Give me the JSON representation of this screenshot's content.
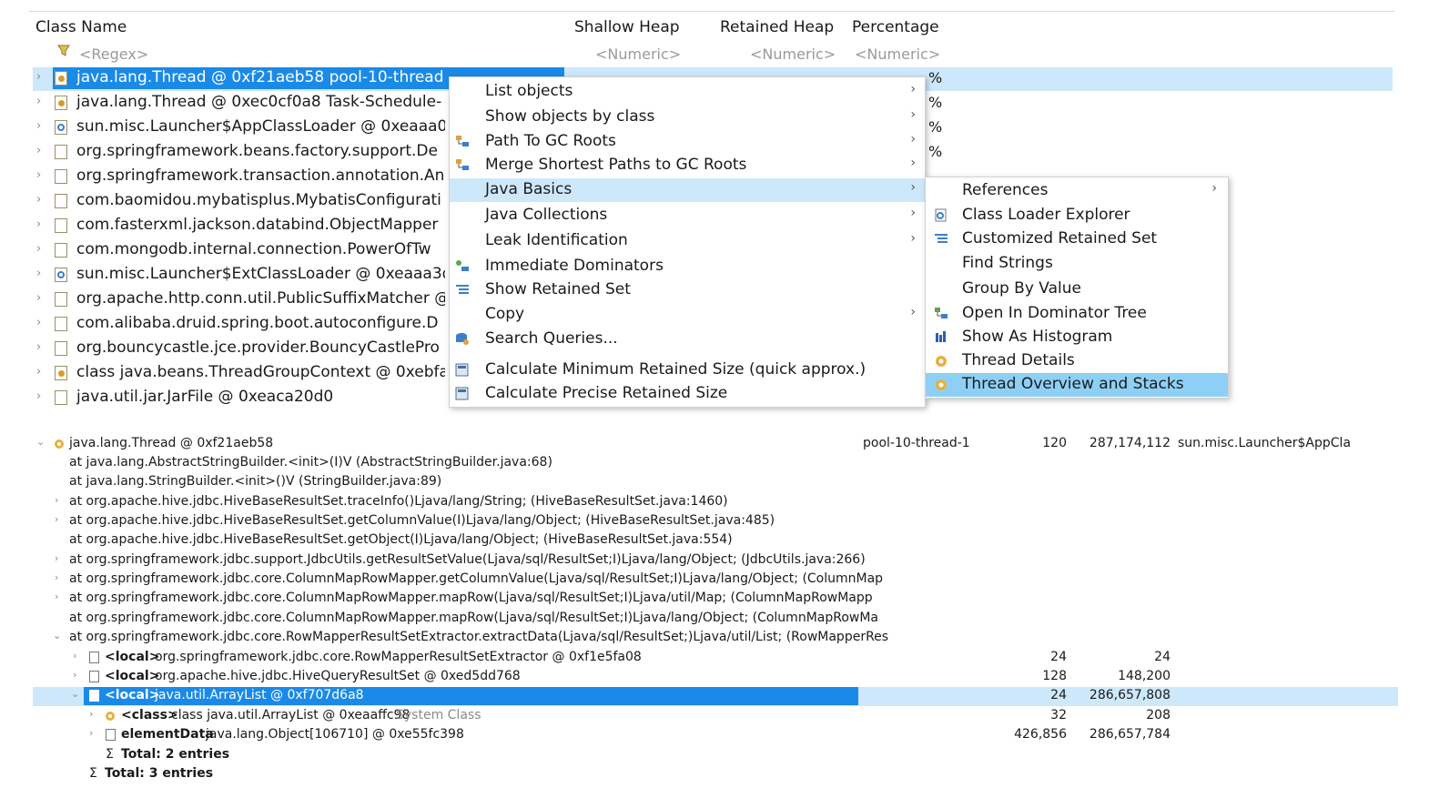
{
  "columns": {
    "class_name": "Class Name",
    "shallow_heap": "Shallow Heap",
    "retained_heap": "Retained Heap",
    "percentage": "Percentage"
  },
  "filters": {
    "regex": "<Regex>",
    "numeric": "<Numeric>"
  },
  "rows": [
    {
      "label": "java.lang.Thread @ 0xf21aeb58  pool-10-thread",
      "icon": "thread-icon"
    },
    {
      "label": "java.lang.Thread @ 0xec0cf0a8  Task-Schedule-",
      "icon": "thread-icon"
    },
    {
      "label": "sun.misc.Launcher$AppClassLoader @ 0xeaaa0",
      "icon": "classloader-icon"
    },
    {
      "label": "org.springframework.beans.factory.support.De",
      "icon": "object-icon"
    },
    {
      "label": "org.springframework.transaction.annotation.An",
      "icon": "object-icon"
    },
    {
      "label": "com.baomidou.mybatisplus.MybatisConfigurati",
      "icon": "object-icon"
    },
    {
      "label": "com.fasterxml.jackson.databind.ObjectMapper",
      "icon": "object-icon"
    },
    {
      "label": "com.mongodb.internal.connection.PowerOfTw",
      "icon": "object-icon"
    },
    {
      "label": "sun.misc.Launcher$ExtClassLoader @ 0xeaaa3d",
      "icon": "classloader-icon"
    },
    {
      "label": "org.apache.http.conn.util.PublicSuffixMatcher @",
      "icon": "object-icon"
    },
    {
      "label": "com.alibaba.druid.spring.boot.autoconfigure.D",
      "icon": "object-icon"
    },
    {
      "label": "org.bouncycastle.jce.provider.BouncyCastlePro",
      "icon": "object-icon"
    },
    {
      "label": "class java.beans.ThreadGroupContext @ 0xebfa",
      "icon": "class-icon"
    },
    {
      "label": "java.util.jar.JarFile @ 0xeaca20d0",
      "icon": "object-icon"
    }
  ],
  "pct_marks": [
    "%",
    "%",
    "%",
    "%"
  ],
  "context_menu": {
    "items": [
      {
        "label": "List objects",
        "submenu": true
      },
      {
        "label": "Show objects by class",
        "submenu": true
      },
      {
        "label": "Path To GC Roots",
        "submenu": true,
        "icon": "path-gc-icon"
      },
      {
        "label": "Merge Shortest Paths to GC Roots",
        "submenu": true,
        "icon": "merge-paths-icon"
      },
      {
        "label": "Java Basics",
        "submenu": true,
        "highlighted": true
      },
      {
        "label": "Java Collections",
        "submenu": true
      },
      {
        "label": "Leak Identification",
        "submenu": true
      },
      {
        "label": "Immediate Dominators",
        "icon": "dominators-icon"
      },
      {
        "label": "Show Retained Set",
        "icon": "retained-set-icon"
      },
      {
        "label": "Copy",
        "submenu": true
      },
      {
        "label": "Search Queries...",
        "icon": "search-queries-icon"
      },
      {
        "label": "Calculate Minimum Retained Size (quick approx.)",
        "icon": "calculator-icon"
      },
      {
        "label": "Calculate Precise Retained Size",
        "icon": "calculator-icon"
      }
    ]
  },
  "java_basics_menu": {
    "items": [
      {
        "label": "References",
        "submenu": true
      },
      {
        "label": "Class Loader Explorer",
        "icon": "classloader-icon"
      },
      {
        "label": "Customized Retained Set",
        "icon": "retained-set-icon"
      },
      {
        "label": "Find Strings"
      },
      {
        "label": "Group By Value"
      },
      {
        "label": "Open In Dominator Tree",
        "icon": "dominator-tree-icon"
      },
      {
        "label": "Show As Histogram",
        "icon": "histogram-icon"
      },
      {
        "label": "Thread Details",
        "icon": "thread-icon"
      },
      {
        "label": "Thread Overview and Stacks",
        "icon": "thread-icon",
        "highlighted": true
      }
    ]
  },
  "stack": {
    "thread": {
      "label": "java.lang.Thread @ 0xf21aeb58",
      "name": "pool-10-thread-1",
      "shallow": "120",
      "retained": "287,174,112",
      "loader": "sun.misc.Launcher$AppClas"
    },
    "frames": [
      "at java.lang.AbstractStringBuilder.<init>(I)V (AbstractStringBuilder.java:68)",
      "at java.lang.StringBuilder.<init>()V (StringBuilder.java:89)",
      "at org.apache.hive.jdbc.HiveBaseResultSet.traceInfo()Ljava/lang/String; (HiveBaseResultSet.java:1460)",
      "at org.apache.hive.jdbc.HiveBaseResultSet.getColumnValue(I)Ljava/lang/Object; (HiveBaseResultSet.java:485)",
      "at org.apache.hive.jdbc.HiveBaseResultSet.getObject(I)Ljava/lang/Object; (HiveBaseResultSet.java:554)",
      "at org.springframework.jdbc.support.JdbcUtils.getResultSetValue(Ljava/sql/ResultSet;I)Ljava/lang/Object; (JdbcUtils.java:266)",
      "at org.springframework.jdbc.core.ColumnMapRowMapper.getColumnValue(Ljava/sql/ResultSet;I)Ljava/lang/Object; (ColumnMap",
      "at org.springframework.jdbc.core.ColumnMapRowMapper.mapRow(Ljava/sql/ResultSet;I)Ljava/util/Map; (ColumnMapRowMapp",
      "at org.springframework.jdbc.core.ColumnMapRowMapper.mapRow(Ljava/sql/ResultSet;I)Ljava/lang/Object; (ColumnMapRowMa",
      "at org.springframework.jdbc.core.RowMapperResultSetExtractor.extractData(Ljava/sql/ResultSet;)Ljava/util/List; (RowMapperRes"
    ],
    "locals": [
      {
        "tag": "<local>",
        "label": "org.springframework.jdbc.core.RowMapperResultSetExtractor @ 0xf1e5fa08",
        "shallow": "24",
        "retained": "24"
      },
      {
        "tag": "<local>",
        "label": "org.apache.hive.jdbc.HiveQueryResultSet @ 0xed5dd768",
        "shallow": "128",
        "retained": "148,200"
      },
      {
        "tag": "<local>",
        "label": "java.util.ArrayList @ 0xf707d6a8",
        "shallow": "24",
        "retained": "286,657,808"
      }
    ],
    "children": [
      {
        "tag": "<class>",
        "label": "class java.util.ArrayList @ 0xeaaffc98",
        "extra": "System Class",
        "shallow": "32",
        "retained": "208"
      },
      {
        "tag": "elementData",
        "label": "java.lang.Object[106710] @ 0xe55fc398",
        "shallow": "426,856",
        "retained": "286,657,784"
      }
    ],
    "total_inner": "Total: 2 entries",
    "total_outer": "Total: 3 entries"
  }
}
